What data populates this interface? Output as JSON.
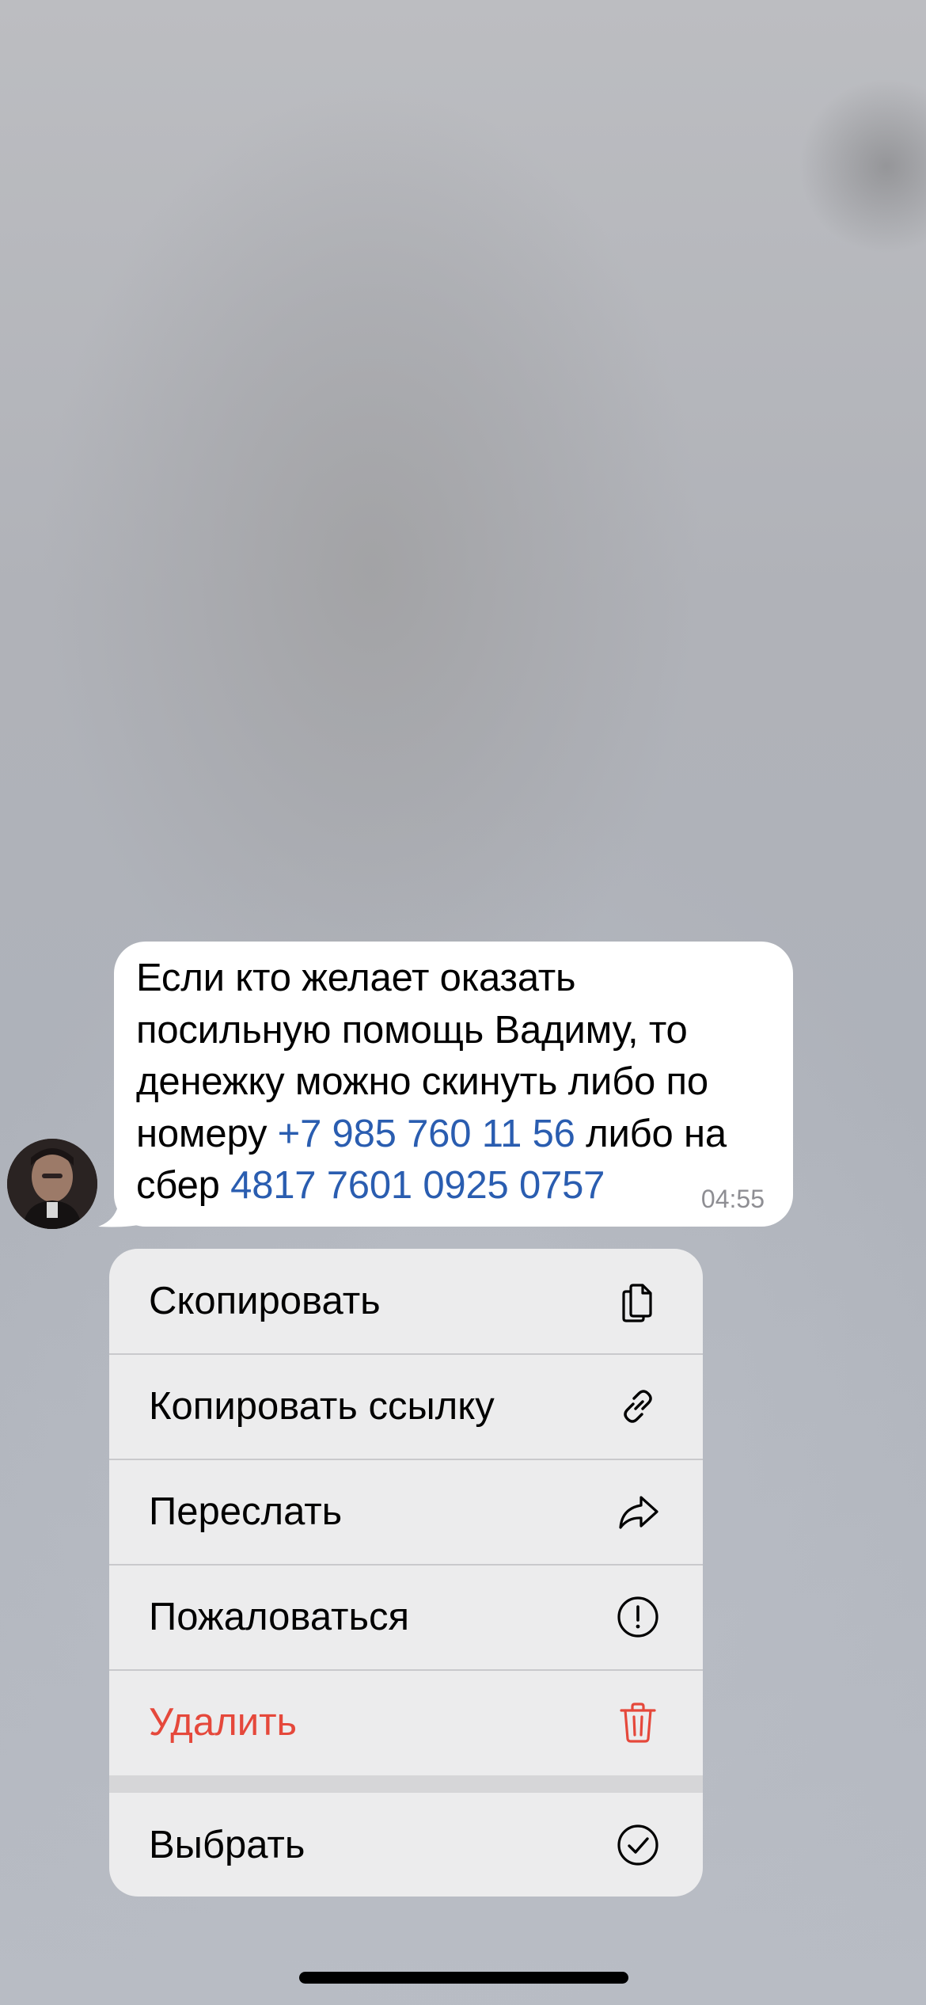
{
  "message": {
    "text_lines": [
      "Если кто желает оказать",
      "посильную помощь Вадиму, то",
      "денежку можно скинуть либо по"
    ],
    "line4_prefix": "номеру ",
    "phone_link": "+7 985 760 11 56",
    "line4_suffix": " либо на",
    "line5_prefix": "сбер ",
    "card_link": "4817 7601 0925 0757",
    "time": "04:55"
  },
  "menu": {
    "copy": "Скопировать",
    "copy_link": "Копировать ссылку",
    "forward": "Переслать",
    "report": "Пожаловаться",
    "delete": "Удалить",
    "select": "Выбрать"
  },
  "colors": {
    "link": "#2a5db0",
    "danger": "#e5483b",
    "menu_bg": "#ececed"
  },
  "icons": {
    "copy": "copy-icon",
    "copy_link": "link-icon",
    "forward": "forward-icon",
    "report": "report-icon",
    "delete": "trash-icon",
    "select": "checkmark-circle-icon"
  }
}
